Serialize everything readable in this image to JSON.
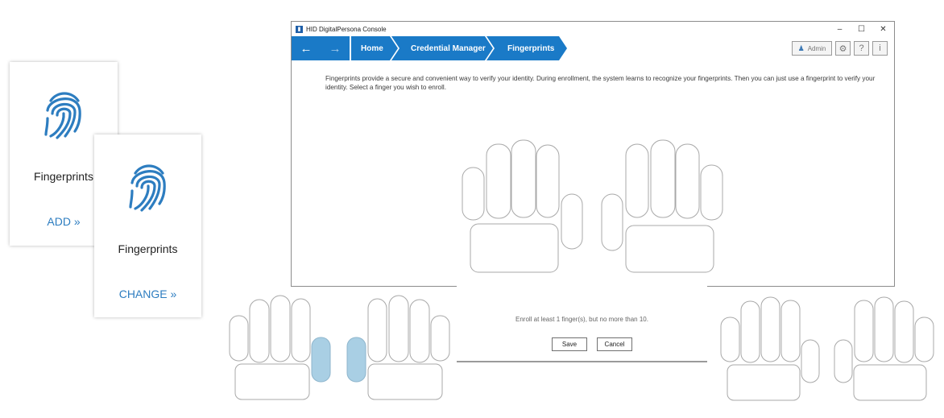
{
  "tiles": {
    "add": {
      "title": "Fingerprints",
      "action": "ADD »"
    },
    "change": {
      "title": "Fingerprints",
      "action": "CHANGE »"
    }
  },
  "window": {
    "title": "HID DigitalPersona Console",
    "controls": {
      "minimize": "–",
      "maximize": "☐",
      "close": "✕"
    }
  },
  "nav": {
    "back_icon": "←",
    "forward_icon": "→",
    "breadcrumbs": [
      "Home",
      "Credential Manager",
      "Fingerprints"
    ],
    "admin_label": "Admin",
    "gear_icon": "⚙",
    "help_label": "?",
    "info_label": "i"
  },
  "content": {
    "intro": "Fingerprints provide a secure and convenient way to verify your identity. During enrollment, the system learns to recognize your fingerprints. Then you can just use a fingerprint to verify your identity. Select a finger you wish to enroll.",
    "enroll_message": "Enroll at least 1 finger(s), but no more than 10.",
    "save_label": "Save",
    "cancel_label": "Cancel"
  },
  "colors": {
    "accent": "#1a7ac7",
    "link": "#2d7dc0",
    "selected_finger": "#a9cfe4"
  }
}
